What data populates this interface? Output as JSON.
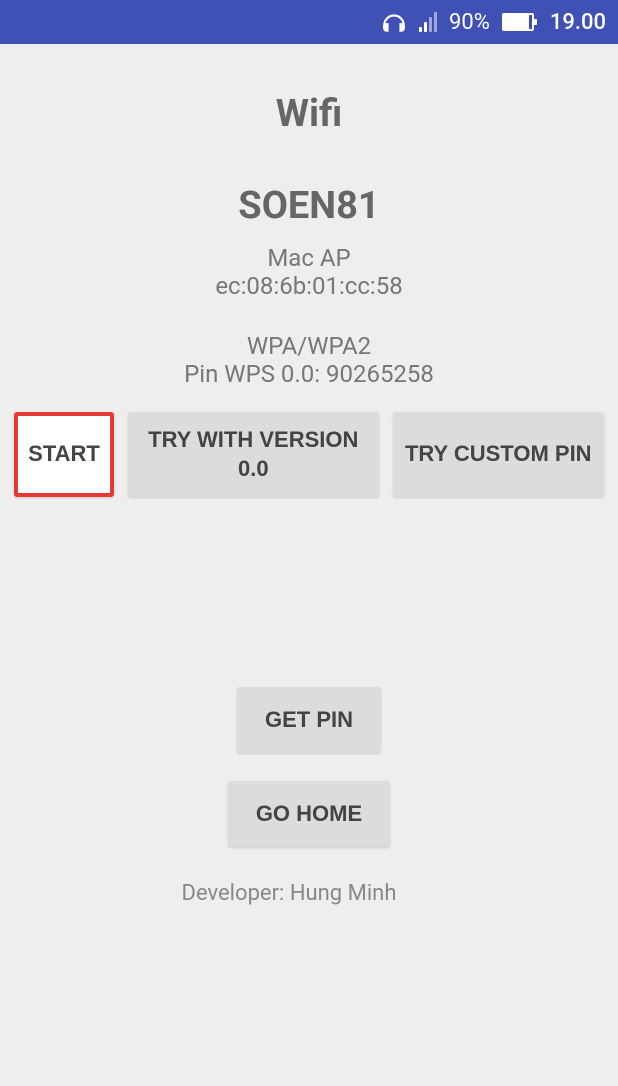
{
  "status": {
    "battery_percent": "90%",
    "time": "19.00"
  },
  "main": {
    "title": "Wifi",
    "ssid": "SOEN81",
    "mac_label": "Mac AP",
    "mac_value": "ec:08:6b:01:cc:58",
    "security": "WPA/WPA2",
    "pin_line": "Pin WPS 0.0: 90265258"
  },
  "buttons": {
    "start": "START",
    "try_version": "TRY WITH VERSION 0.0",
    "try_custom": "TRY CUSTOM PIN",
    "get_pin": "GET PIN",
    "go_home": "GO HOME"
  },
  "footer": {
    "developer": "Developer: Hung Minh"
  }
}
